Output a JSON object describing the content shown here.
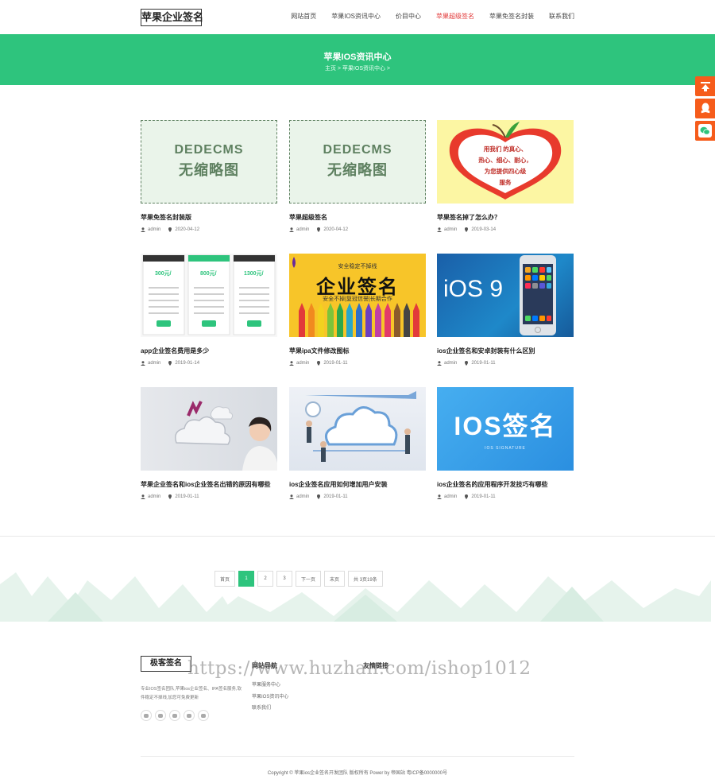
{
  "header": {
    "logo": "苹果企业签名",
    "nav": [
      {
        "label": "网站首页"
      },
      {
        "label": "苹果IOS资讯中心"
      },
      {
        "label": "价目中心"
      },
      {
        "label": "苹果超级签名"
      },
      {
        "label": "苹果免签名封装"
      },
      {
        "label": "联系我们"
      }
    ]
  },
  "banner": {
    "title": "苹果IOS资讯中心",
    "breadcrumb": "主页 > 苹果IOS资讯中心 >"
  },
  "articles": [
    {
      "title": "苹果免签名封装版",
      "author": "admin",
      "date": "2020-04-12",
      "thumb": "dedecms-placeholder"
    },
    {
      "title": "苹果超级签名",
      "author": "admin",
      "date": "2020-04-12",
      "thumb": "dedecms-placeholder"
    },
    {
      "title": "苹果签名掉了怎么办？",
      "author": "admin",
      "date": "2019-03-14",
      "thumb": "apple-heart"
    },
    {
      "title": "app企业签名费用是多少",
      "author": "admin",
      "date": "2019-01-14",
      "thumb": "price-cards"
    },
    {
      "title": "苹果ipa文件修改图标",
      "author": "admin",
      "date": "2019-01-11",
      "thumb": "pencils-banner"
    },
    {
      "title": "ios企业签名和安卓封装有什么区别",
      "author": "admin",
      "date": "2019-01-11",
      "thumb": "ios9-phone"
    },
    {
      "title": "苹果企业签名和ios企业签名出错的原因有哪些",
      "author": "admin",
      "date": "2019-01-11",
      "thumb": "cloud-woman"
    },
    {
      "title": "ios企业签名应用如何增加用户安装",
      "author": "admin",
      "date": "2019-01-11",
      "thumb": "cloud-people"
    },
    {
      "title": "ios企业签名的应用程序开发技巧有哪些",
      "author": "admin",
      "date": "2019-01-11",
      "thumb": "ios-signature"
    }
  ],
  "dede": {
    "en": "DEDECMS",
    "cn": "无缩略图"
  },
  "thumb_text": {
    "heart_lines": [
      "用我们 的真心、",
      "热心、细心、耐心，",
      "为您提供四心级",
      "服务"
    ],
    "pencils_top": "安全稳定不掉线",
    "pencils_main": "企业签名",
    "pencils_sub": "安全不掉|复冠信誉|长期合作",
    "prices": [
      "300元/",
      "800元/",
      "1300元/"
    ],
    "ios9": "iOS 9",
    "ios_sign": "IOS签名",
    "ios_sign_sub": "IOS SIGNATURE"
  },
  "pagination": {
    "items": [
      {
        "label": "首页",
        "active": false
      },
      {
        "label": "1",
        "active": true
      },
      {
        "label": "2",
        "active": false
      },
      {
        "label": "3",
        "active": false
      },
      {
        "label": "下一页",
        "active": false
      },
      {
        "label": "末页",
        "active": false
      },
      {
        "label": "共 3页19条",
        "active": false
      }
    ]
  },
  "footer": {
    "logo": "极客签名",
    "desc": "专业IOS签名团队,苹果ios企业签名、IPA签名服务,软件稳定不掉线,加您可免费更新",
    "nav_title": "网站导航",
    "nav_links": [
      "苹果服务中心",
      "苹果IOS资讯中心",
      "联系我们"
    ],
    "friend_title": "友情链接",
    "watermark": "https://www.huzhan.com/ishop1012",
    "copyright": "Copyright © 苹果ios企业签名开发团队 版权所有 Power by 帝国站 粤ICP备0000000号"
  },
  "colors": {
    "brand": "#2ec47d",
    "active_nav": "#e23a3a",
    "side_float": "#f65c1b"
  }
}
